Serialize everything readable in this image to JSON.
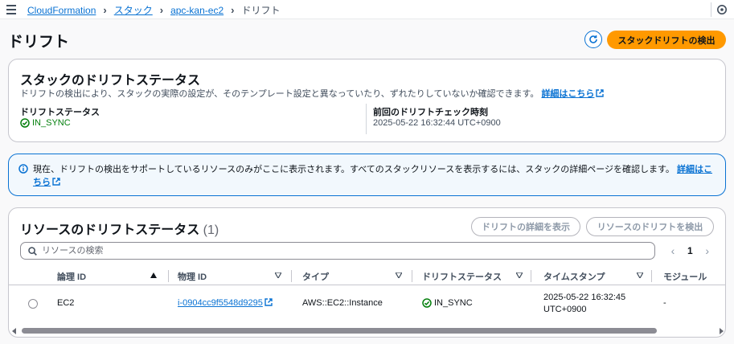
{
  "breadcrumb": {
    "items": [
      "CloudFormation",
      "スタック",
      "apc-kan-ec2"
    ],
    "current": "ドリフト"
  },
  "header": {
    "title": "ドリフト",
    "detect_button": "スタックドリフトの検出"
  },
  "stack_status": {
    "title": "スタックのドリフトステータス",
    "description": "ドリフトの検出により、スタックの実際の設定が、そのテンプレート設定と異なっていたり、ずれたりしていないか確認できます。",
    "learn_more": "詳細はこちら",
    "drift_status_label": "ドリフトステータス",
    "drift_status_value": "IN_SYNC",
    "last_check_label": "前回のドリフトチェック時刻",
    "last_check_value": "2025-05-22 16:32:44 UTC+0900"
  },
  "alert": {
    "text": "現在、ドリフトの検出をサポートしているリソースのみがここに表示されます。すべてのスタックリソースを表示するには、スタックの詳細ページを確認します。",
    "link": "詳細はこちら"
  },
  "resources": {
    "title": "リソースのドリフトステータス",
    "count": "(1)",
    "view_details_button": "ドリフトの詳細を表示",
    "detect_resource_button": "リソースのドリフトを検出",
    "search_placeholder": "リソースの検索",
    "page": "1",
    "columns": [
      "論理 ID",
      "物理 ID",
      "タイプ",
      "ドリフトステータス",
      "タイムスタンプ",
      "モジュール"
    ],
    "rows": [
      {
        "logical_id": "EC2",
        "physical_id": "i-0904cc9f5548d9295",
        "type": "AWS::EC2::Instance",
        "drift_status": "IN_SYNC",
        "timestamp_line1": "2025-05-22 16:32:45",
        "timestamp_line2": "UTC+0900",
        "module": "-"
      }
    ]
  },
  "colors": {
    "link": "#0972d3",
    "primary": "#ff9900",
    "success": "#037f0c",
    "info_bg": "#f2f8fd"
  },
  "icons": [
    "menu-icon",
    "chevron-right-icon",
    "settings-icon",
    "refresh-icon",
    "external-link-icon",
    "status-success-icon",
    "info-icon",
    "search-icon",
    "sort-ascending-icon",
    "sort-descending-icon",
    "chevron-left-icon"
  ]
}
